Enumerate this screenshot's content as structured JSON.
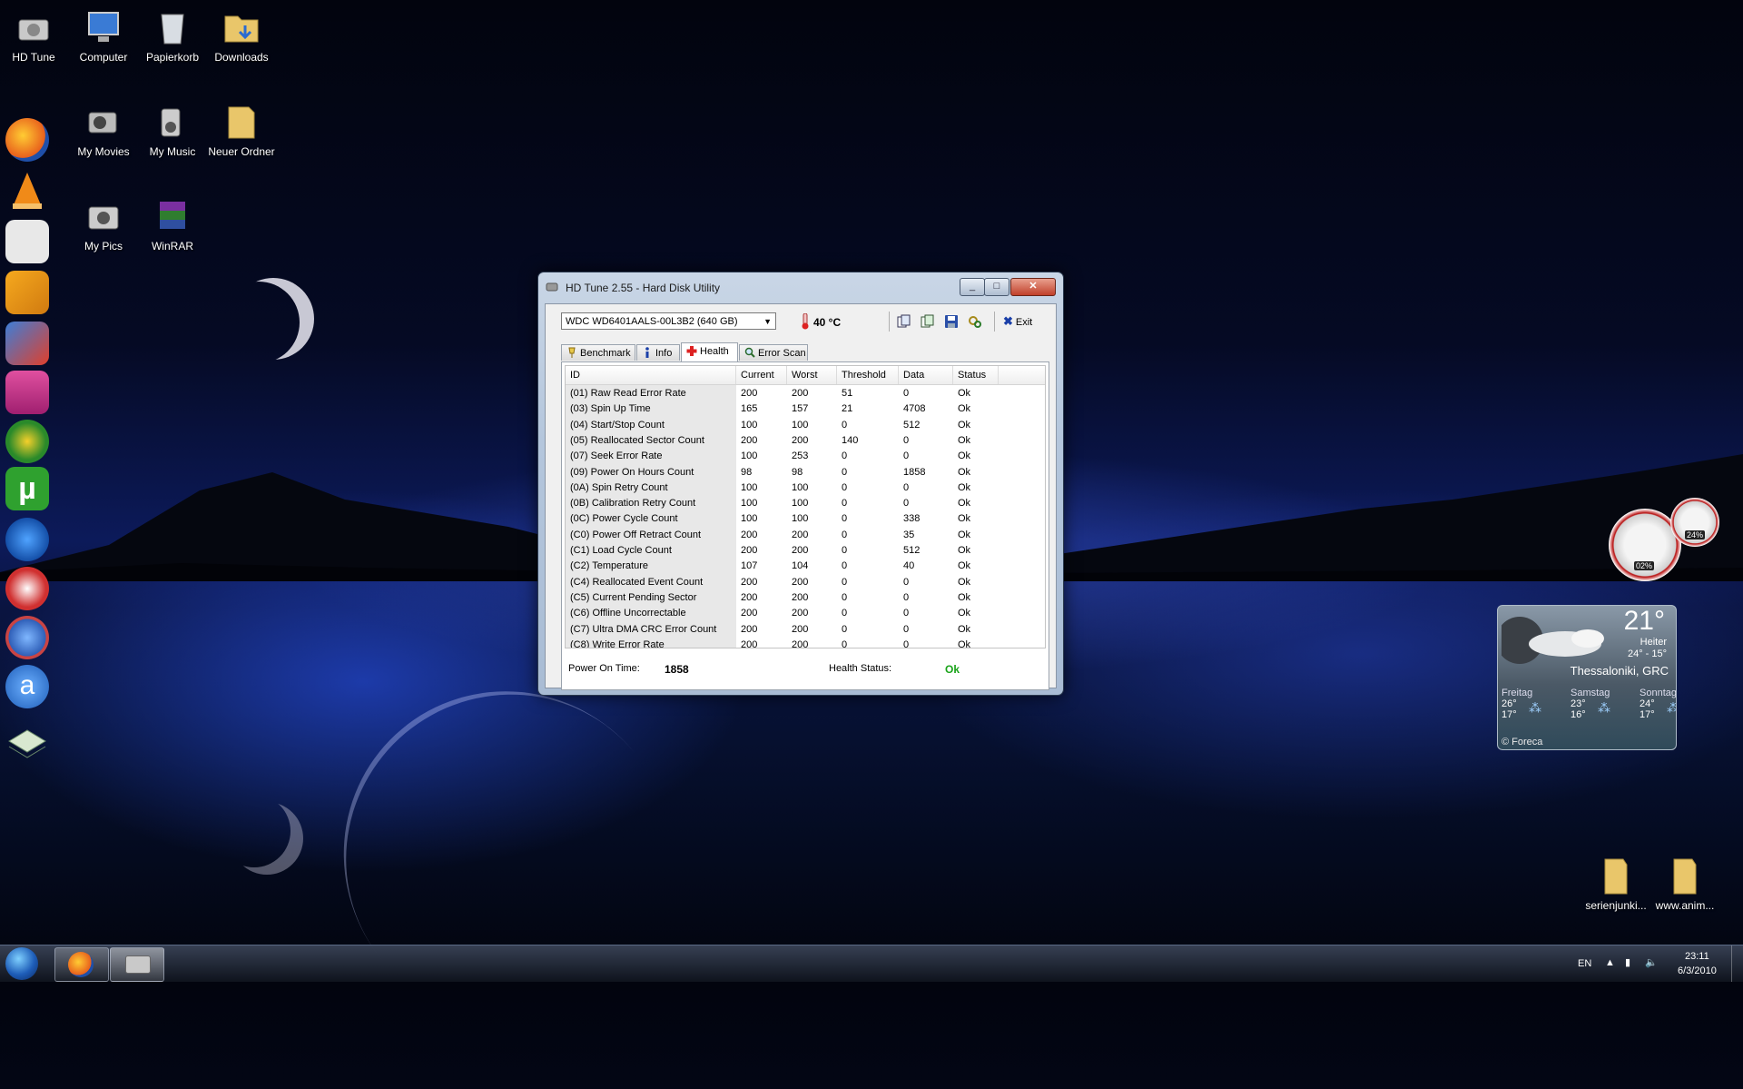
{
  "desktop": {
    "icons": [
      {
        "label": "HD Tune",
        "icon": "hdtune-icon"
      },
      {
        "label": "Computer",
        "icon": "computer-icon"
      },
      {
        "label": "Papierkorb",
        "icon": "recycle-bin-icon"
      },
      {
        "label": "Downloads",
        "icon": "folder-icon"
      },
      {
        "label": "My Movies",
        "icon": "camera-icon"
      },
      {
        "label": "My Music",
        "icon": "music-icon"
      },
      {
        "label": "Neuer Ordner",
        "icon": "folder-icon"
      },
      {
        "label": "My Pics",
        "icon": "camera-icon"
      },
      {
        "label": "WinRAR",
        "icon": "winrar-icon"
      },
      {
        "label": "serienjunki...",
        "icon": "folder-icon"
      },
      {
        "label": "www.anim...",
        "icon": "folder-icon"
      }
    ]
  },
  "window": {
    "title": "HD Tune 2.55 - Hard Disk Utility",
    "drive": "WDC WD6401AALS-00L3B2 (640 GB)",
    "temperature": "40 °C",
    "exit_label": "Exit",
    "tabs": [
      {
        "label": "Benchmark"
      },
      {
        "label": "Info"
      },
      {
        "label": "Health"
      },
      {
        "label": "Error Scan"
      }
    ],
    "columns": [
      "ID",
      "Current",
      "Worst",
      "Threshold",
      "Data",
      "Status"
    ],
    "rows": [
      [
        "(01) Raw Read Error Rate",
        "200",
        "200",
        "51",
        "0",
        "Ok"
      ],
      [
        "(03) Spin Up Time",
        "165",
        "157",
        "21",
        "4708",
        "Ok"
      ],
      [
        "(04) Start/Stop Count",
        "100",
        "100",
        "0",
        "512",
        "Ok"
      ],
      [
        "(05) Reallocated Sector Count",
        "200",
        "200",
        "140",
        "0",
        "Ok"
      ],
      [
        "(07) Seek Error Rate",
        "100",
        "253",
        "0",
        "0",
        "Ok"
      ],
      [
        "(09) Power On Hours Count",
        "98",
        "98",
        "0",
        "1858",
        "Ok"
      ],
      [
        "(0A) Spin Retry Count",
        "100",
        "100",
        "0",
        "0",
        "Ok"
      ],
      [
        "(0B) Calibration Retry Count",
        "100",
        "100",
        "0",
        "0",
        "Ok"
      ],
      [
        "(0C) Power Cycle Count",
        "100",
        "100",
        "0",
        "338",
        "Ok"
      ],
      [
        "(C0) Power Off Retract Count",
        "200",
        "200",
        "0",
        "35",
        "Ok"
      ],
      [
        "(C1) Load Cycle Count",
        "200",
        "200",
        "0",
        "512",
        "Ok"
      ],
      [
        "(C2) Temperature",
        "107",
        "104",
        "0",
        "40",
        "Ok"
      ],
      [
        "(C4) Reallocated Event Count",
        "200",
        "200",
        "0",
        "0",
        "Ok"
      ],
      [
        "(C5) Current Pending Sector",
        "200",
        "200",
        "0",
        "0",
        "Ok"
      ],
      [
        "(C6) Offline Uncorrectable",
        "200",
        "200",
        "0",
        "0",
        "Ok"
      ],
      [
        "(C7) Ultra DMA CRC Error Count",
        "200",
        "200",
        "0",
        "0",
        "Ok"
      ],
      [
        "(C8) Write Error Rate",
        "200",
        "200",
        "0",
        "0",
        "Ok"
      ]
    ],
    "summary": {
      "power_on_label": "Power On Time:",
      "power_on_value": "1858",
      "health_label": "Health Status:",
      "health_value": "Ok"
    }
  },
  "gadgets": {
    "meter_small": "24%",
    "meter_large": "02%",
    "weather": {
      "temp": "21°",
      "condition": "Heiter",
      "hilo": "24° - 15°",
      "city": "Thessaloniki, GRC",
      "forecast": [
        {
          "day": "Freitag",
          "hi": "26°",
          "lo": "17°"
        },
        {
          "day": "Samstag",
          "hi": "23°",
          "lo": "16°"
        },
        {
          "day": "Sonntag",
          "hi": "24°",
          "lo": "17°"
        }
      ],
      "credit": "© Foreca"
    }
  },
  "taskbar": {
    "language": "EN",
    "time": "23:11",
    "date": "6/3/2010"
  },
  "colors": {
    "ok_green": "#19a319",
    "title_text": "#1b1b1b"
  }
}
